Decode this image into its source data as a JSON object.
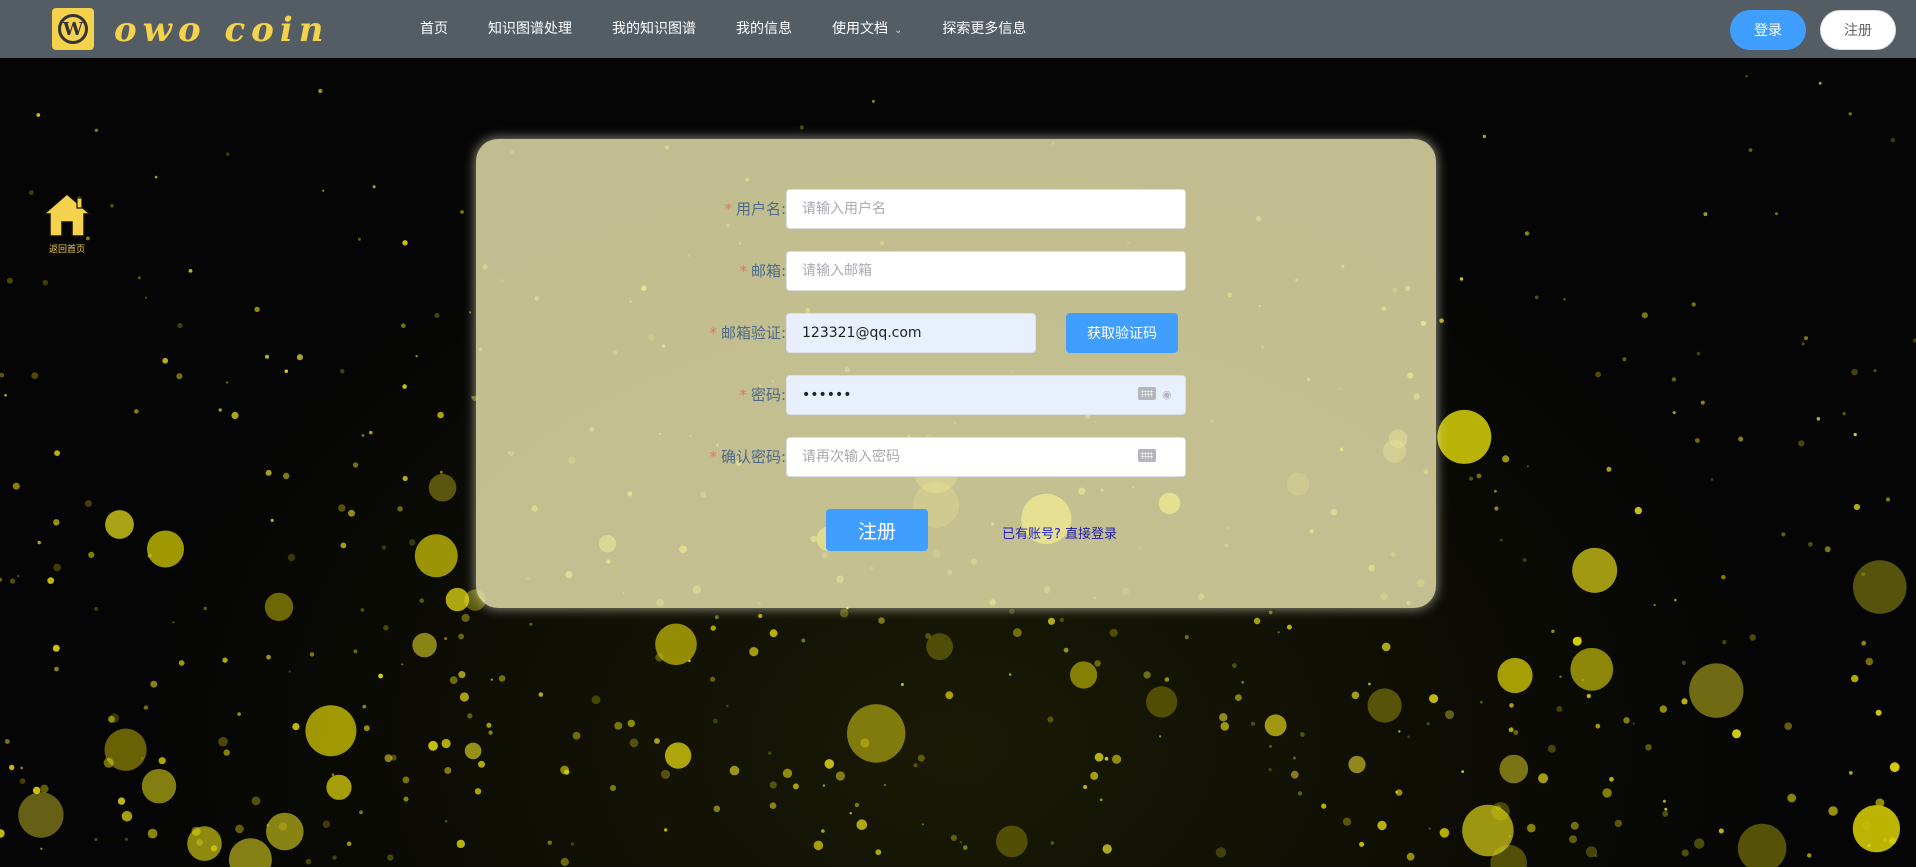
{
  "header": {
    "logo_letter": "W",
    "brand": "owo coin",
    "nav": [
      {
        "label": "首页"
      },
      {
        "label": "知识图谱处理"
      },
      {
        "label": "我的知识图谱"
      },
      {
        "label": "我的信息"
      },
      {
        "label": "使用文档",
        "dropdown": true
      },
      {
        "label": "探索更多信息"
      }
    ],
    "login_label": "登录",
    "register_label": "注册"
  },
  "home_link": {
    "label": "返回首页",
    "icon": "home-icon"
  },
  "form": {
    "username": {
      "label": "用户名:",
      "placeholder": "请输入用户名",
      "value": ""
    },
    "email": {
      "label": "邮箱:",
      "placeholder": "请输入邮箱",
      "value": ""
    },
    "email_verify": {
      "label": "邮箱验证:",
      "value": "123321@qq.com",
      "button": "获取验证码"
    },
    "password": {
      "label": "密码:",
      "value": "••••••"
    },
    "confirm_password": {
      "label": "确认密码:",
      "placeholder": "请再次输入密码",
      "value": ""
    },
    "submit_label": "注册",
    "have_account": "已有账号?",
    "login_link": "直接登录"
  },
  "colors": {
    "header_bg": "#545c64",
    "accent": "#409eff",
    "brand": "#f4d24c",
    "required": "#f56c6c"
  }
}
